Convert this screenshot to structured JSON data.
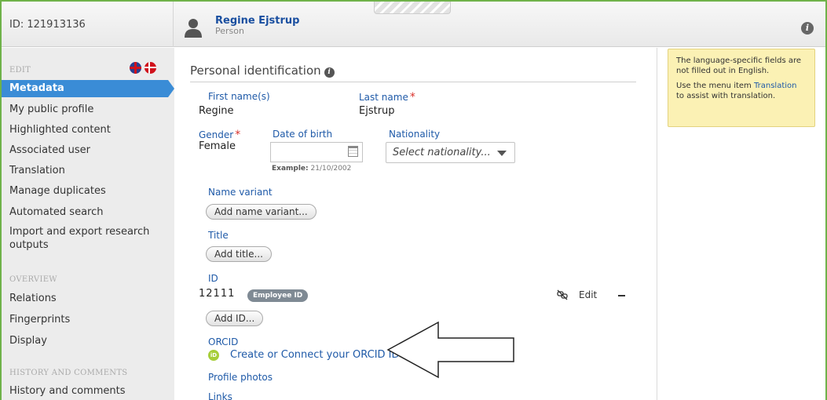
{
  "header": {
    "id_text": "ID: 121913136",
    "person_name": "Regine Ejstrup",
    "person_type": "Person",
    "info_icon": "i"
  },
  "sidebar": {
    "edit_label": "EDIT",
    "overview_label": "OVERVIEW",
    "history_label": "HISTORY AND COMMENTS",
    "edit_items": [
      {
        "label": "Metadata",
        "active": true
      },
      {
        "label": "My public profile"
      },
      {
        "label": "Highlighted content"
      },
      {
        "label": "Associated user"
      },
      {
        "label": "Translation"
      },
      {
        "label": "Manage duplicates"
      },
      {
        "label": "Automated search"
      },
      {
        "label": "Import and export research outputs"
      }
    ],
    "overview_items": [
      {
        "label": "Relations"
      },
      {
        "label": "Fingerprints"
      },
      {
        "label": "Display"
      }
    ],
    "history_items": [
      {
        "label": "History and comments"
      }
    ],
    "flags": [
      "uk-flag",
      "denmark-flag"
    ]
  },
  "main": {
    "section_title": "Personal identification",
    "first_name_label": "First name(s)",
    "first_name_value": "Regine",
    "last_name_label": "Last name",
    "last_name_value": "Ejstrup",
    "gender_label": "Gender",
    "gender_value": "Female",
    "dob_label": "Date of birth",
    "dob_value": "",
    "dob_example_label": "Example:",
    "dob_example_value": "21/10/2002",
    "nationality_label": "Nationality",
    "nationality_placeholder": "Select nationality...",
    "name_variant_label": "Name variant",
    "add_name_variant": "Add name variant...",
    "title_label": "Title",
    "add_title": "Add title...",
    "id_label": "ID",
    "id_value": "12111",
    "id_badge": "Employee ID",
    "edit_label": "Edit",
    "add_id": "Add ID...",
    "orcid_label": "ORCID",
    "orcid_icon_text": "iD",
    "orcid_link": "Create or Connect your ORCID ID",
    "profile_photos_label": "Profile photos",
    "links_label": "Links"
  },
  "notice": {
    "line1": "The language-specific fields are not filled out in English.",
    "line2_prefix": "Use the menu item ",
    "line2_link": "Translation",
    "line2_suffix": " to assist with translation."
  },
  "colors": {
    "accent_blue": "#3a8cd6",
    "link_blue": "#1f5aa8",
    "required_red": "#d9322b",
    "notice_bg": "#fbf1b4",
    "frame_green": "#6fb24a",
    "orcid_green": "#a6ce39"
  }
}
